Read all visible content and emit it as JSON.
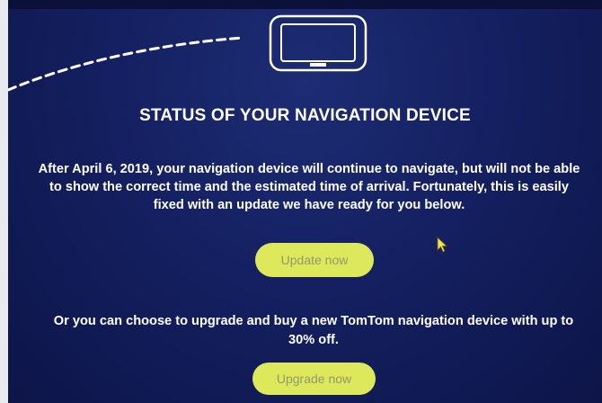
{
  "page": {
    "title": "STATUS OF YOUR NAVIGATION DEVICE",
    "message": "After April 6, 2019, your navigation device will continue to navigate, but will not be able to show the correct time and the estimated time of arrival. Fortunately, this is easily fixed with an update we have ready for you below.",
    "update_button": "Update now",
    "upgrade_message": "Or you can choose to upgrade and buy a new TomTom navigation device with up to 30% off.",
    "upgrade_button": "Upgrade now"
  },
  "icons": {
    "device": "navigation-device-icon",
    "route": "dashed-route-icon",
    "cursor": "mouse-cursor-icon"
  },
  "colors": {
    "background": "#142061",
    "button": "#dde85a",
    "button_text": "#8f9a6e",
    "text": "#ffffff"
  }
}
